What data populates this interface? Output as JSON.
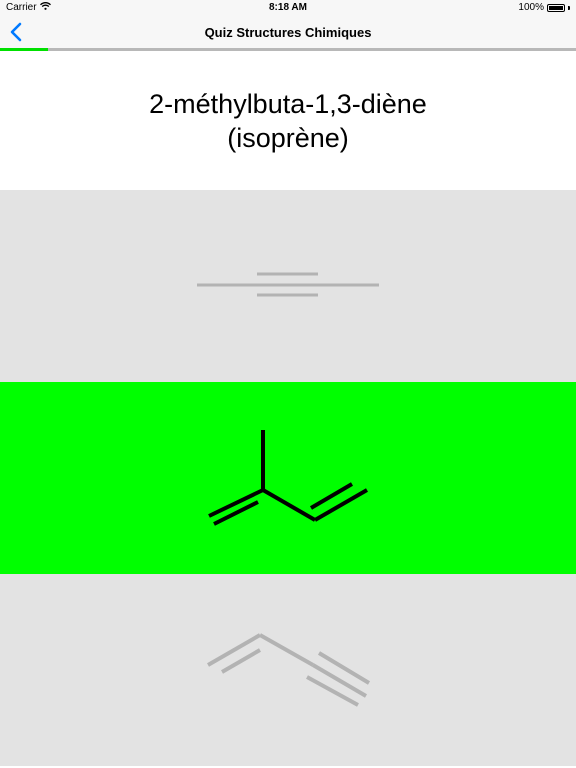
{
  "status_bar": {
    "carrier": "Carrier",
    "time": "8:18 AM",
    "battery": "100%"
  },
  "nav": {
    "title": "Quiz Structures Chimiques",
    "back_icon": "chevron-left-icon",
    "accent_color": "#007aff"
  },
  "progress": {
    "fraction": 0.083,
    "color": "#00e000"
  },
  "question": {
    "line1": "2-méthylbuta-1,3-diène",
    "line2": "(isoprène)"
  },
  "answers": [
    {
      "molecule_icon": "triple-bond-structure-icon",
      "state": "dimmed",
      "background": "#e3e3e3"
    },
    {
      "molecule_icon": "isoprene-structure-icon",
      "state": "correct",
      "background": "#00ff00"
    },
    {
      "molecule_icon": "but-1-en-3-yne-structure-icon",
      "state": "dimmed",
      "background": "#e3e3e3"
    }
  ]
}
